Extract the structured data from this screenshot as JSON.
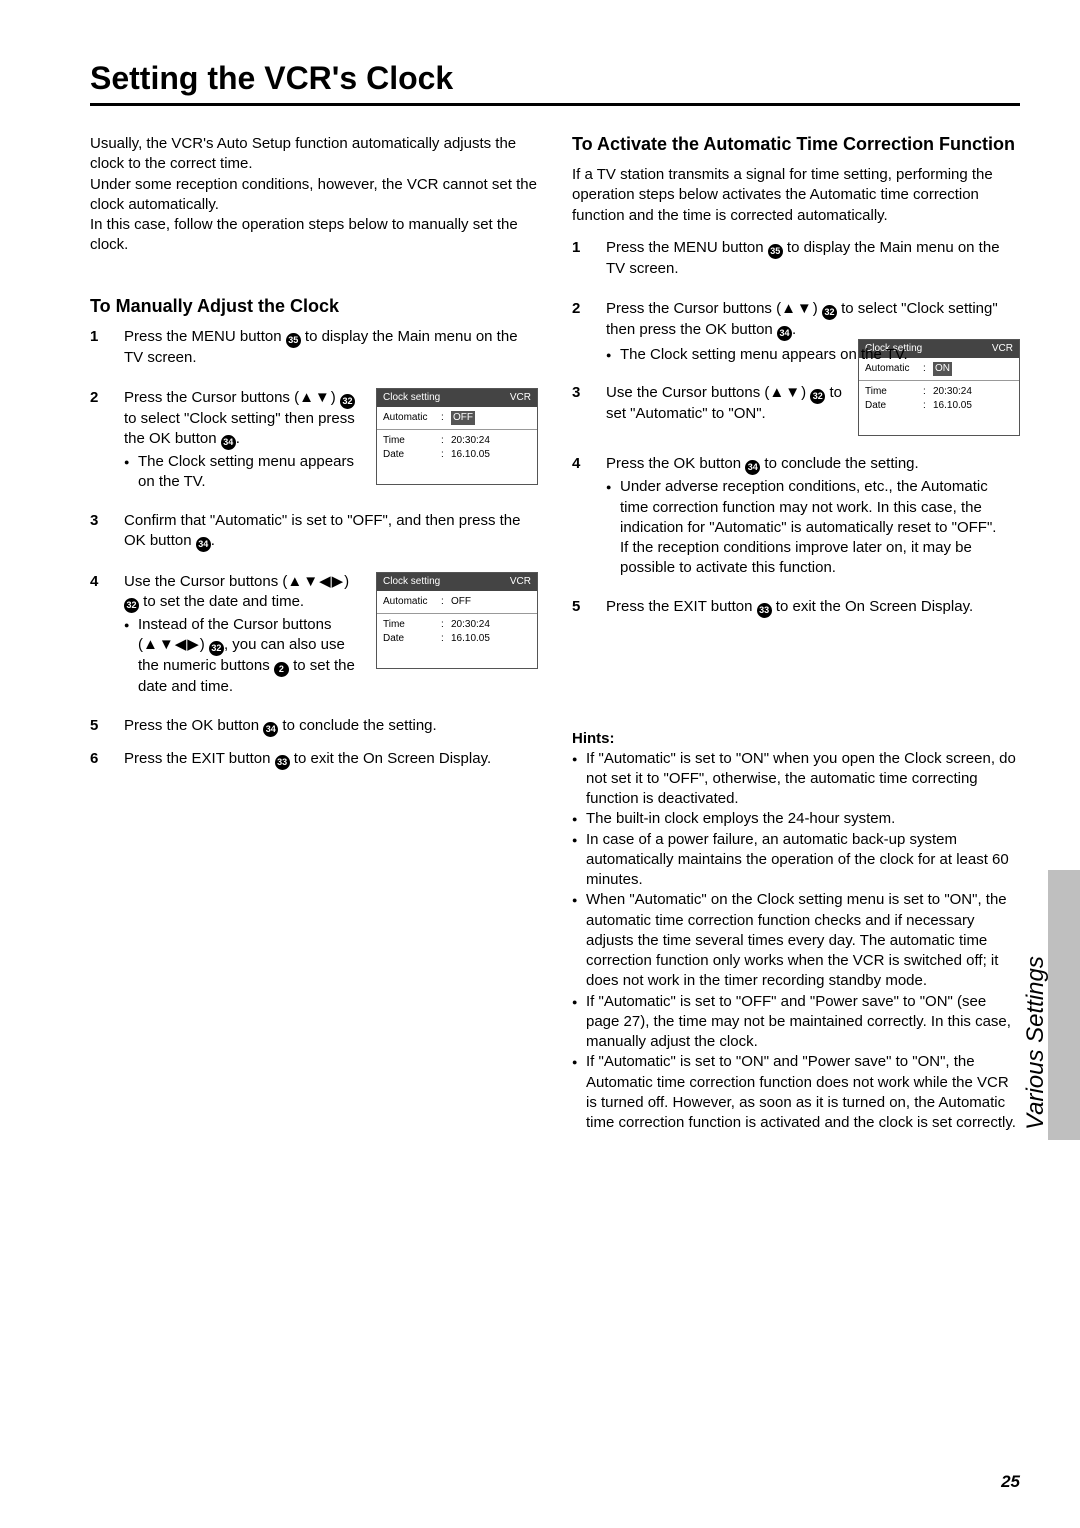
{
  "title": "Setting the VCR's Clock",
  "side_label": "Various Settings",
  "page_number": "25",
  "intro": [
    "Usually, the VCR's Auto Setup function automatically adjusts the clock to the correct time.",
    "Under some reception conditions, however, the VCR cannot set the clock automatically.",
    "In this case, follow the operation steps below to manually set the clock."
  ],
  "left": {
    "heading": "To Manually Adjust the Clock",
    "steps": {
      "s1": {
        "t1": "Press the MENU button ",
        "t2": " to display the Main menu on the TV screen."
      },
      "s2": {
        "t1": "Press the Cursor buttons (",
        "arrows": "▲▼",
        "t2": ") ",
        "t3": " to select \"Clock setting\" then press the OK button ",
        "t4": ".",
        "sub": "The Clock setting menu appears on the TV."
      },
      "s3": {
        "t1": "Confirm that \"Automatic\" is set to \"OFF\", and then press the OK button ",
        "t2": "."
      },
      "s4": {
        "t1": "Use the Cursor buttons (",
        "arrows1": "▲▼◀▶",
        "t2": ") ",
        "t3": " to set the date and time.",
        "sub_a": "Instead of the Cursor buttons (",
        "arrows2": "▲▼◀▶",
        "sub_b": ") ",
        "sub_c": ", you can also use the numeric buttons ",
        "sub_d": " to set the date and time."
      },
      "s5": {
        "t1": "Press the OK button ",
        "t2": " to conclude the setting."
      },
      "s6": {
        "t1": "Press the EXIT button ",
        "t2": " to exit the On Screen Display."
      }
    }
  },
  "right": {
    "heading": "To Activate the Automatic Time Correction Function",
    "intro": "If a TV station transmits a signal for time setting, performing the operation steps below activates the Automatic time correction function and the time is corrected automatically.",
    "steps": {
      "s1": {
        "t1": "Press the MENU button ",
        "t2": " to display the Main menu on the TV screen."
      },
      "s2": {
        "t1": "Press the Cursor buttons (",
        "arrows": "▲▼",
        "t2": ") ",
        "t3": " to select \"Clock setting\" then press the OK button ",
        "t4": ".",
        "sub": "The Clock setting menu appears on the TV."
      },
      "s3": {
        "t1": "Use the Cursor buttons (",
        "arrows": "▲▼",
        "t2": ") ",
        "t3": " to set \"Automatic\" to \"ON\"."
      },
      "s4": {
        "t1": "Press the OK button ",
        "t2": " to conclude the setting.",
        "sub1": "Under adverse reception conditions, etc., the Automatic time correction function may not work. In this case, the indication for \"Automatic\" is automatically reset to \"OFF\".",
        "sub2": "If the reception conditions improve later on, it may be possible to activate this function."
      },
      "s5": {
        "t1": "Press the EXIT button ",
        "t2": " to exit the On Screen Display."
      }
    }
  },
  "hints_heading": "Hints:",
  "hints": [
    "If \"Automatic\" is set to \"ON\" when you open the Clock screen, do not set it to \"OFF\", otherwise, the automatic time correcting function is deactivated.",
    "The built-in clock employs the 24-hour system.",
    "In case of a power failure, an automatic back-up system automatically maintains the operation of the clock for at least 60 minutes.",
    "When \"Automatic\" on the Clock setting menu is set to \"ON\", the automatic time correction function checks and if necessary adjusts the time several times every day. The automatic time correction function only works when the VCR is switched off; it does not work in the timer recording standby mode.",
    "If \"Automatic\" is set to \"OFF\" and \"Power save\" to \"ON\" (see page 27), the time may not be maintained correctly. In this case, manually adjust the clock.",
    "If \"Automatic\" is set to \"ON\" and \"Power save\" to \"ON\", the Automatic time correction function does not work while the VCR is turned off. However, as soon as it is turned on, the Automatic time correction function is activated and the clock is set correctly."
  ],
  "refs": {
    "menu": "35",
    "cursor": "32",
    "ok": "34",
    "numeric": "2",
    "exit": "33"
  },
  "osd": {
    "title": "Clock setting",
    "corner": "VCR",
    "k_auto": "Automatic",
    "k_time": "Time",
    "k_date": "Date",
    "v_time": "20:30:24",
    "v_date": "16.10.05",
    "v_off": "OFF",
    "v_on": "ON",
    "colon": ":"
  }
}
